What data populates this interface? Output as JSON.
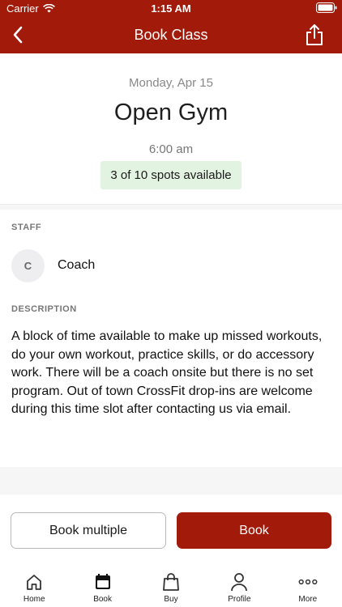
{
  "status_bar": {
    "carrier": "Carrier",
    "time": "1:15 AM"
  },
  "nav": {
    "title": "Book Class",
    "back_icon": "chevron-left-icon",
    "share_icon": "share-icon"
  },
  "class_info": {
    "date": "Monday, Apr 15",
    "title": "Open Gym",
    "time": "6:00 am",
    "spots": "3 of 10 spots available"
  },
  "staff": {
    "label": "STAFF",
    "initial": "C",
    "name": "Coach"
  },
  "description": {
    "label": "DESCRIPTION",
    "text": "A block of time available to make up missed workouts, do your own workout, practice skills, or do accessory work. There will be a coach onsite but there is no set program.  Out of town CrossFit drop-ins are welcome during this time slot after contacting us via email."
  },
  "actions": {
    "book_multiple": "Book multiple",
    "book": "Book"
  },
  "tabs": [
    {
      "label": "Home",
      "icon": "home-icon"
    },
    {
      "label": "Book",
      "icon": "calendar-icon",
      "active": true
    },
    {
      "label": "Buy",
      "icon": "shopping-bag-icon"
    },
    {
      "label": "Profile",
      "icon": "profile-icon"
    },
    {
      "label": "More",
      "icon": "more-icon"
    }
  ],
  "colors": {
    "brand": "#a11a0a",
    "spots_badge_bg": "#e3f3e1",
    "muted_text": "#888888"
  }
}
